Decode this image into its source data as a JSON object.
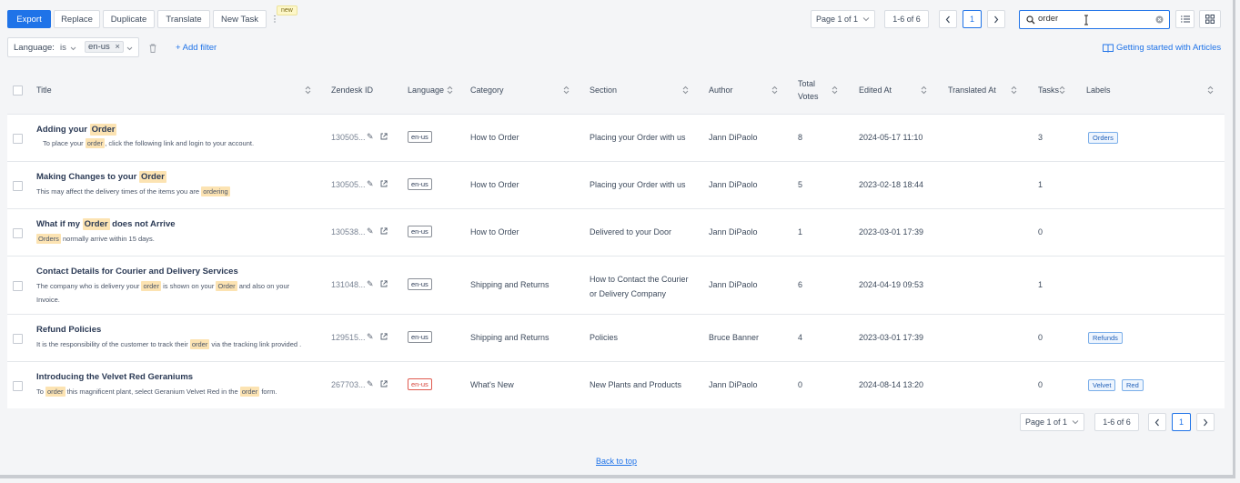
{
  "toolbar": {
    "export": "Export",
    "replace": "Replace",
    "duplicate": "Duplicate",
    "translate": "Translate",
    "new_task": "New Task",
    "more": "⋮",
    "new_badge": "new"
  },
  "pager_top": {
    "page": "Page 1 of 1",
    "range": "1-6 of 6",
    "current": "1"
  },
  "pager_bottom": {
    "page": "Page 1 of 1",
    "range": "1-6 of 6",
    "current": "1"
  },
  "search": {
    "value": "order"
  },
  "filter": {
    "field": "Language:",
    "op": "is",
    "value": "en-us",
    "add": "+ Add filter"
  },
  "getting_started": "Getting started with Articles",
  "columns": {
    "title": "Title",
    "zendesk_id": "Zendesk ID",
    "language": "Language",
    "category": "Category",
    "section": "Section",
    "author": "Author",
    "votes_1": "Total",
    "votes_2": "Votes",
    "edited": "Edited At",
    "translated": "Translated At",
    "tasks": "Tasks",
    "labels": "Labels"
  },
  "rows": [
    {
      "title_a": "Adding your ",
      "title_hl": "Order",
      "title_b": "",
      "snippet": [
        "To place your ",
        "order",
        ", click the following link and login to your account."
      ],
      "zid": "130505...",
      "lang": "en-us",
      "category": "How to Order",
      "section": "Placing your Order with us",
      "author": "Jann DiPaolo",
      "votes": "8",
      "edited": "2024-05-17 11:10",
      "tasks": "3",
      "labels": [
        "Orders"
      ]
    },
    {
      "title_a": "Making Changes to your ",
      "title_hl": "Order",
      "title_b": "",
      "snippet": [
        "This may affect the delivery times of the items you are ",
        "ordering",
        ""
      ],
      "zid": "130505...",
      "lang": "en-us",
      "category": "How to Order",
      "section": "Placing your Order with us",
      "author": "Jann DiPaolo",
      "votes": "5",
      "edited": "2023-02-18 18:44",
      "tasks": "1",
      "labels": []
    },
    {
      "title_a": "What if my ",
      "title_hl": "Order",
      "title_b": " does not Arrive",
      "snippet": [
        "",
        "Orders",
        " normally arrive within 15 days."
      ],
      "zid": "130538...",
      "lang": "en-us",
      "category": "How to Order",
      "section": "Delivered to your Door",
      "author": "Jann DiPaolo",
      "votes": "1",
      "edited": "2023-03-01 17:39",
      "tasks": "0",
      "labels": []
    },
    {
      "title_a": "Contact Details for Courier and Delivery Services",
      "title_hl": "",
      "title_b": "",
      "snippet_line1": [
        "The company who is delivery your ",
        "order",
        " is shown on your ",
        "Order",
        " and also on your"
      ],
      "snippet_line2": "Invoice.",
      "zid": "131048...",
      "lang": "en-us",
      "category": "Shipping and Returns",
      "section_1": "How to Contact the Courier",
      "section_2": "or Delivery Company",
      "author": "Jann DiPaolo",
      "votes": "6",
      "edited": "2024-04-19 09:53",
      "tasks": "1",
      "labels": []
    },
    {
      "title_a": "Refund Policies",
      "title_hl": "",
      "title_b": "",
      "snippet": [
        "It is the responsibility of the customer to track their ",
        "order",
        " via the tracking link provided ."
      ],
      "zid": "129515...",
      "lang": "en-us",
      "category": "Shipping and Returns",
      "section": "Policies",
      "author": "Bruce Banner",
      "votes": "4",
      "edited": "2023-03-01 17:39",
      "tasks": "0",
      "labels": [
        "Refunds"
      ]
    },
    {
      "title_a": "Introducing the Velvet Red Geraniums",
      "title_hl": "",
      "title_b": "",
      "snippet_multi": [
        "To ",
        "order",
        " this magnificent plant, select Geranium Velvet Red in the ",
        "order",
        " form."
      ],
      "zid": "267703...",
      "lang": "en-us",
      "lang_color": "#d6443a",
      "category": "What's New",
      "section": "New Plants and Products",
      "author": "Jann DiPaolo",
      "votes": "0",
      "edited": "2024-08-14 13:20",
      "tasks": "0",
      "labels": [
        "Velvet",
        "Red"
      ]
    }
  ],
  "back_to_top": "Back to top",
  "colors": {
    "accent": "#1f73e8",
    "highlight": "#fce3b2",
    "lang_warning": "#d6443a"
  }
}
